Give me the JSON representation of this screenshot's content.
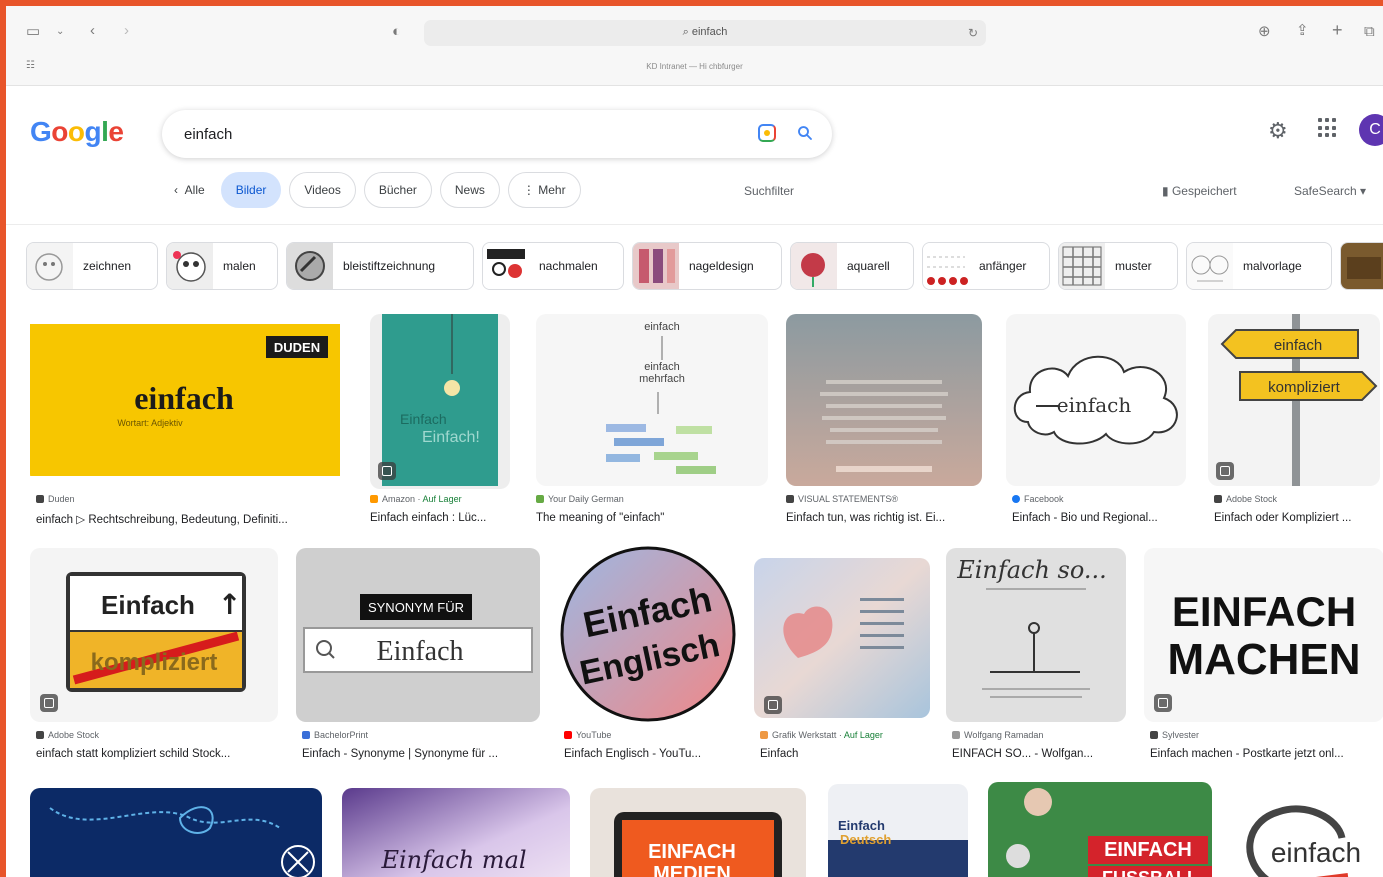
{
  "browser": {
    "address": "einfach",
    "subline": "KD Intranet — Hi chbfurger"
  },
  "google": {
    "logo": [
      "G",
      "o",
      "o",
      "g",
      "l",
      "e"
    ],
    "search_value": "einfach",
    "avatar_letter": "C",
    "tabs": [
      "Alle",
      "Bilder",
      "Videos",
      "Bücher",
      "News",
      "Mehr"
    ],
    "suchfilter": "Suchfilter",
    "saved": "Gespeichert",
    "safesearch": "SafeSearch"
  },
  "chips": [
    "zeichnen",
    "malen",
    "bleistiftzeichnung",
    "nachmalen",
    "nageldesign",
    "aquarell",
    "anfänger",
    "muster",
    "malvorlage"
  ],
  "row1": [
    {
      "source": "Duden",
      "title": "einfach ▷ Rechtschreibung, Bedeutung, Definiti...",
      "t1": "einfach",
      "t2": "Wortart: Adjektiv",
      "badge_text": "DUDEN"
    },
    {
      "source": "Amazon",
      "stock": "Auf Lager",
      "title": "Einfach einfach : Lüc...",
      "t1": "Einfach",
      "t2": "Einfach!"
    },
    {
      "source": "Your Daily German",
      "title": "The meaning of \"einfach\"",
      "t1": "einfach",
      "t2": "einfach",
      "t3": "mehrfach"
    },
    {
      "source": "VISUAL STATEMENTS®",
      "title": "Einfach tun, was richtig ist. Ei..."
    },
    {
      "source": "Facebook",
      "title": "Einfach - Bio und Regional...",
      "t1": "einfach"
    },
    {
      "source": "Adobe Stock",
      "title": "Einfach oder Kompliziert ...",
      "t1": "einfach",
      "t2": "kompliziert"
    }
  ],
  "row2": [
    {
      "source": "Adobe Stock",
      "title": "einfach statt kompliziert schild Stock...",
      "t1": "Einfach",
      "t2": "kompliziert"
    },
    {
      "source": "BachelorPrint",
      "title": "Einfach - Synonyme | Synonyme für ...",
      "t1": "SYNONYM FÜR",
      "t2": "Einfach"
    },
    {
      "source": "YouTube",
      "title": "Einfach Englisch - YouTu...",
      "t1": "Einfach",
      "t2": "Englisch"
    },
    {
      "source": "Grafik Werkstatt",
      "stock": "Auf Lager",
      "title": "Einfach"
    },
    {
      "source": "Wolfgang Ramadan",
      "title": "EINFACH SO... - Wolfgan...",
      "t1": "Einfach so..."
    },
    {
      "source": "Sylvester",
      "title": "Einfach machen - Postkarte jetzt onl...",
      "t1": "EINFACH",
      "t2": "MACHEN"
    }
  ],
  "row3": [
    {
      "t1": ""
    },
    {
      "t1": "Einfach mal"
    },
    {
      "t1": "EINFACH",
      "t2": "MEDIEN"
    },
    {
      "t1": "Einfach",
      "t2": "Deutsch"
    },
    {
      "t1": "EINFACH",
      "t2": "FUSSBALL"
    },
    {
      "t1": "einfach"
    }
  ]
}
